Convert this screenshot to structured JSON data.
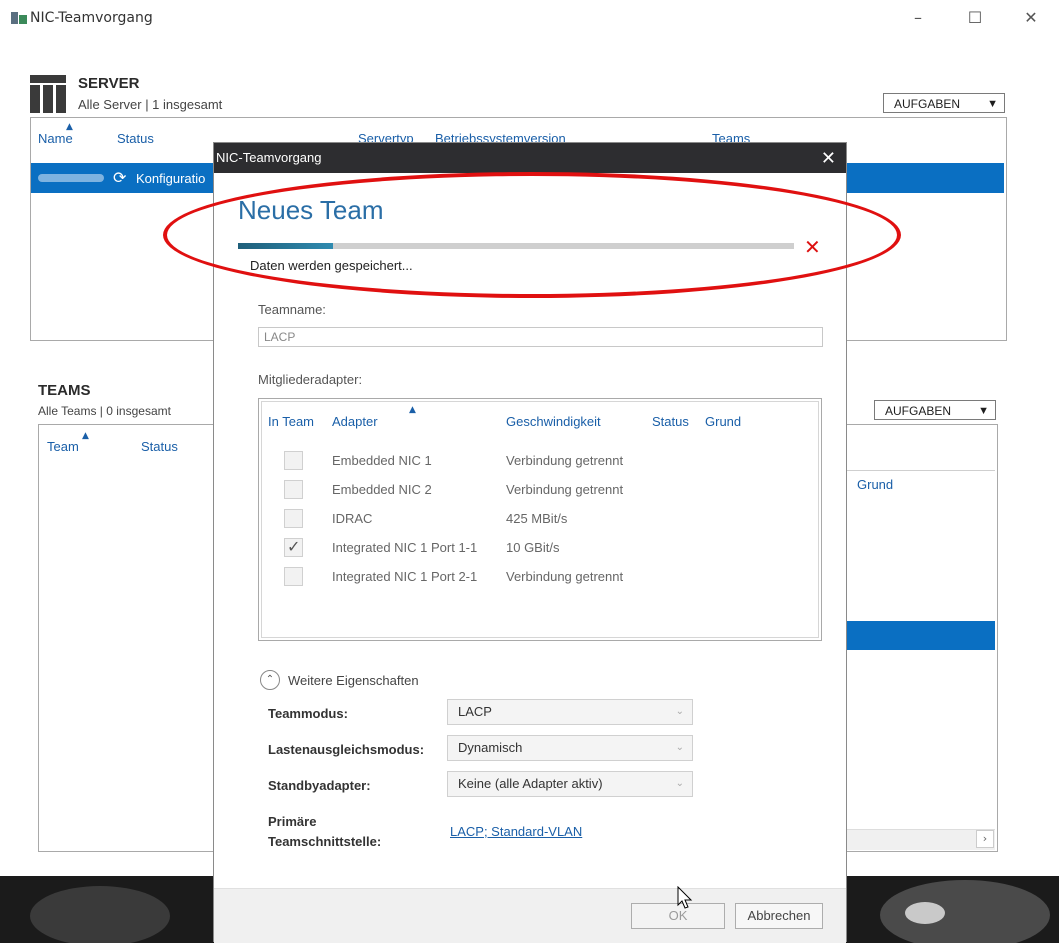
{
  "window": {
    "title": "NIC-Teamvorgang",
    "controls": [
      "–",
      "☐",
      "✕"
    ]
  },
  "server": {
    "title": "SERVER",
    "subtitle": "Alle Server | 1 insgesamt",
    "tasks_label": "AUFGABEN",
    "columns": [
      "Name",
      "Status",
      "Servertyp",
      "Betriebssystemversion",
      "Teams"
    ],
    "row": {
      "status": "Konfiguratio"
    }
  },
  "teams": {
    "title": "TEAMS",
    "subtitle": "Alle Teams | 0 insgesamt",
    "tasks_label": "AUFGABEN",
    "columns": [
      "Team",
      "Status"
    ],
    "right_column": "Grund"
  },
  "dialog": {
    "title": "NIC-Teamvorgang",
    "heading": "Neues Team",
    "progress": 0.17,
    "status_text": "Daten werden gespeichert...",
    "teamname_label": "Teamname:",
    "teamname_value": "LACP",
    "members_label": "Mitgliederadapter:",
    "member_columns": [
      "In Team",
      "Adapter",
      "Geschwindigkeit",
      "Status",
      "Grund"
    ],
    "members": [
      {
        "adapter": "Embedded NIC 1",
        "speed": "Verbindung getrennt",
        "checked": false
      },
      {
        "adapter": "Embedded NIC 2",
        "speed": "Verbindung getrennt",
        "checked": false
      },
      {
        "adapter": "IDRAC",
        "speed": "425 MBit/s",
        "checked": false
      },
      {
        "adapter": "Integrated NIC 1 Port 1-1",
        "speed": "10 GBit/s",
        "checked": true
      },
      {
        "adapter": "Integrated NIC 1 Port 2-1",
        "speed": "Verbindung getrennt",
        "checked": false
      }
    ],
    "more_props": "Weitere Eigenschaften",
    "props": {
      "teammode_label": "Teammodus:",
      "teammode_value": "LACP",
      "lb_label": "Lastenausgleichsmodus:",
      "lb_value": "Dynamisch",
      "standby_label": "Standbyadapter:",
      "standby_value": "Keine (alle Adapter aktiv)",
      "primary_label_1": "Primäre",
      "primary_label_2": "Teamschnittstelle:",
      "primary_value": "LACP; Standard-VLAN"
    },
    "ok_label": "OK",
    "cancel_label": "Abbrechen"
  },
  "colors": {
    "accent": "#0a6fc2",
    "highlight_annotation": "#e01010",
    "dialog_title_bg": "#2d2d30"
  }
}
